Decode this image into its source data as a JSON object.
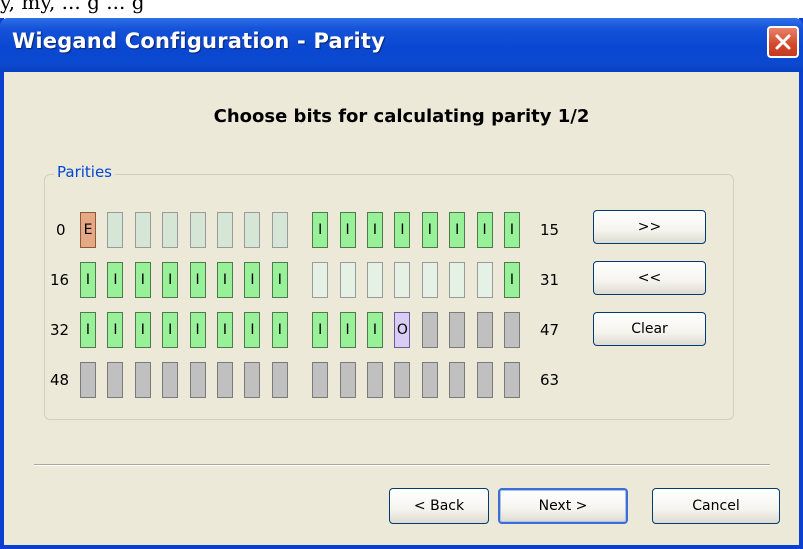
{
  "top_fragment": "y, my, ... g ... g",
  "window": {
    "title": "Wiegand Configuration - Parity",
    "close_icon": "close-icon",
    "accent": "#0a48d2"
  },
  "heading": "Choose bits for calculating parity 1/2",
  "group": {
    "legend": "Parities"
  },
  "rows": [
    {
      "start": "0",
      "end": "15",
      "bits": [
        "E",
        "",
        "",
        "",
        "",
        "",
        "",
        "",
        "I",
        "I",
        "I",
        "I",
        "I",
        "I",
        "I",
        "I"
      ],
      "states": [
        "e",
        "p",
        "p",
        "p",
        "p",
        "p",
        "p",
        "p",
        "i",
        "i",
        "i",
        "i",
        "i",
        "i",
        "i",
        "i"
      ]
    },
    {
      "start": "16",
      "end": "31",
      "bits": [
        "I",
        "I",
        "I",
        "I",
        "I",
        "I",
        "I",
        "I",
        "",
        "",
        "",
        "",
        "",
        "",
        "",
        "I"
      ],
      "states": [
        "i",
        "i",
        "i",
        "i",
        "i",
        "i",
        "i",
        "i",
        "w",
        "w",
        "w",
        "w",
        "w",
        "w",
        "w",
        "i"
      ]
    },
    {
      "start": "32",
      "end": "47",
      "bits": [
        "I",
        "I",
        "I",
        "I",
        "I",
        "I",
        "I",
        "I",
        "I",
        "I",
        "I",
        "O",
        "",
        "",
        "",
        ""
      ],
      "states": [
        "i",
        "i",
        "i",
        "i",
        "i",
        "i",
        "i",
        "i",
        "i",
        "i",
        "i",
        "o",
        "g",
        "g",
        "g",
        "g"
      ]
    },
    {
      "start": "48",
      "end": "63",
      "bits": [
        "",
        "",
        "",
        "",
        "",
        "",
        "",
        "",
        "",
        "",
        "",
        "",
        "",
        "",
        "",
        ""
      ],
      "states": [
        "g",
        "g",
        "g",
        "g",
        "g",
        "g",
        "g",
        "g",
        "g",
        "g",
        "g",
        "g",
        "g",
        "g",
        "g",
        "g"
      ]
    }
  ],
  "side_buttons": {
    "forward": ">>",
    "backward": "<<",
    "clear": "Clear"
  },
  "footer": {
    "back": "< Back",
    "next": "Next >",
    "cancel": "Cancel"
  }
}
